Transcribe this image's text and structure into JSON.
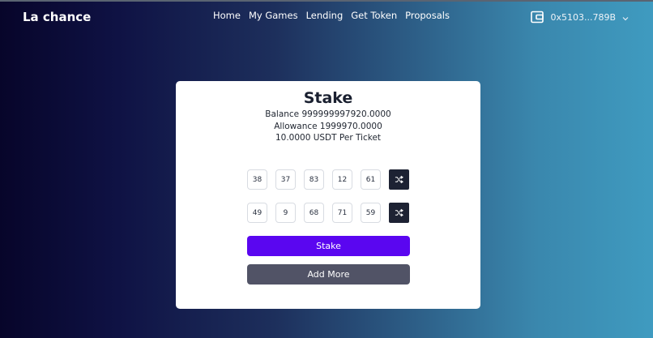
{
  "nav": {
    "brand": "La chance",
    "links": [
      "Home",
      "My Games",
      "Lending",
      "Get Token",
      "Proposals"
    ],
    "wallet_address": "0x5103...789B",
    "wallet_icon": "wallet-icon",
    "chevron_icon": "chevron-down-icon"
  },
  "card": {
    "title": "Stake",
    "balance": "Balance 999999997920.0000",
    "allowance": "Allowance 1999970.0000",
    "price": "10.0000 USDT Per Ticket",
    "rows": [
      [
        "38",
        "37",
        "83",
        "12",
        "61"
      ],
      [
        "49",
        "9",
        "68",
        "71",
        "59"
      ]
    ],
    "shuffle_icon": "shuffle-icon",
    "stake_button": "Stake",
    "add_more_button": "Add More"
  },
  "colors": {
    "stake_button": "#5a06f0",
    "add_more_button": "#515366",
    "shuffle_button": "#1d2233"
  }
}
